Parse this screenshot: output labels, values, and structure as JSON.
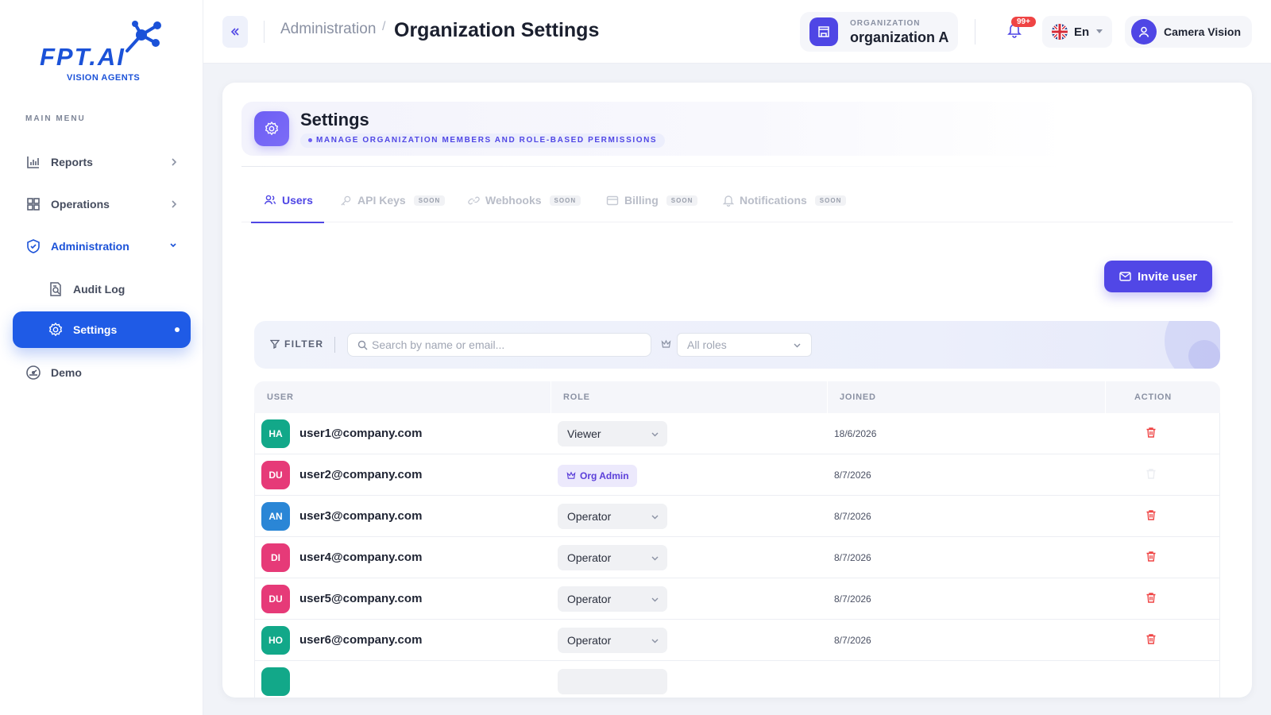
{
  "brand": {
    "logo_text": "FPT.AI",
    "logo_sub": "VISION AGENTS"
  },
  "sidebar": {
    "menu_title": "MAIN MENU",
    "items": [
      {
        "label": "Reports",
        "icon": "bar-chart-icon"
      },
      {
        "label": "Operations",
        "icon": "grid-icon"
      },
      {
        "label": "Administration",
        "icon": "shield-check-icon"
      },
      {
        "label": "Audit Log",
        "icon": "document-search-icon"
      },
      {
        "label": "Settings",
        "icon": "gear-icon"
      },
      {
        "label": "Demo",
        "icon": "gauge-icon"
      }
    ]
  },
  "header": {
    "breadcrumb_parent": "Administration",
    "breadcrumb_sep": "/",
    "title": "Organization Settings",
    "org_label": "ORGANIZATION",
    "org_name": "organization A",
    "notification_count": "99+",
    "language": "En",
    "user_name": "Camera Vision"
  },
  "section": {
    "title": "Settings",
    "subtitle": "MANAGE ORGANIZATION MEMBERS AND ROLE-BASED PERMISSIONS"
  },
  "tabs": [
    {
      "label": "Users",
      "soon": ""
    },
    {
      "label": "API Keys",
      "soon": "SOON"
    },
    {
      "label": "Webhooks",
      "soon": "SOON"
    },
    {
      "label": "Billing",
      "soon": "SOON"
    },
    {
      "label": "Notifications",
      "soon": "SOON"
    }
  ],
  "actions": {
    "invite_label": "Invite user"
  },
  "filter": {
    "label": "FILTER",
    "search_placeholder": "Search by name or email...",
    "role_placeholder": "All roles"
  },
  "table": {
    "columns": [
      "USER",
      "ROLE",
      "JOINED",
      "ACTION"
    ],
    "rows": [
      {
        "initials": "HA",
        "email": "user1@company.com",
        "role": "Viewer",
        "joined": "18/6/2026"
      },
      {
        "initials": "DU",
        "email": "user2@company.com",
        "role": "Org Admin",
        "joined": "8/7/2026"
      },
      {
        "initials": "AN",
        "email": "user3@company.com",
        "role": "Operator",
        "joined": "8/7/2026"
      },
      {
        "initials": "DI",
        "email": "user4@company.com",
        "role": "Operator",
        "joined": "8/7/2026"
      },
      {
        "initials": "DU",
        "email": "user5@company.com",
        "role": "Operator",
        "joined": "8/7/2026"
      },
      {
        "initials": "HO",
        "email": "user6@company.com",
        "role": "Operator",
        "joined": "8/7/2026"
      }
    ]
  },
  "colors": {
    "accent": "#4f46e5",
    "primary_blue": "#1f5be6",
    "danger": "#ef4444",
    "avatar_green": "#12a889",
    "avatar_pink": "#e63a78",
    "avatar_blue": "#2a86d6"
  }
}
